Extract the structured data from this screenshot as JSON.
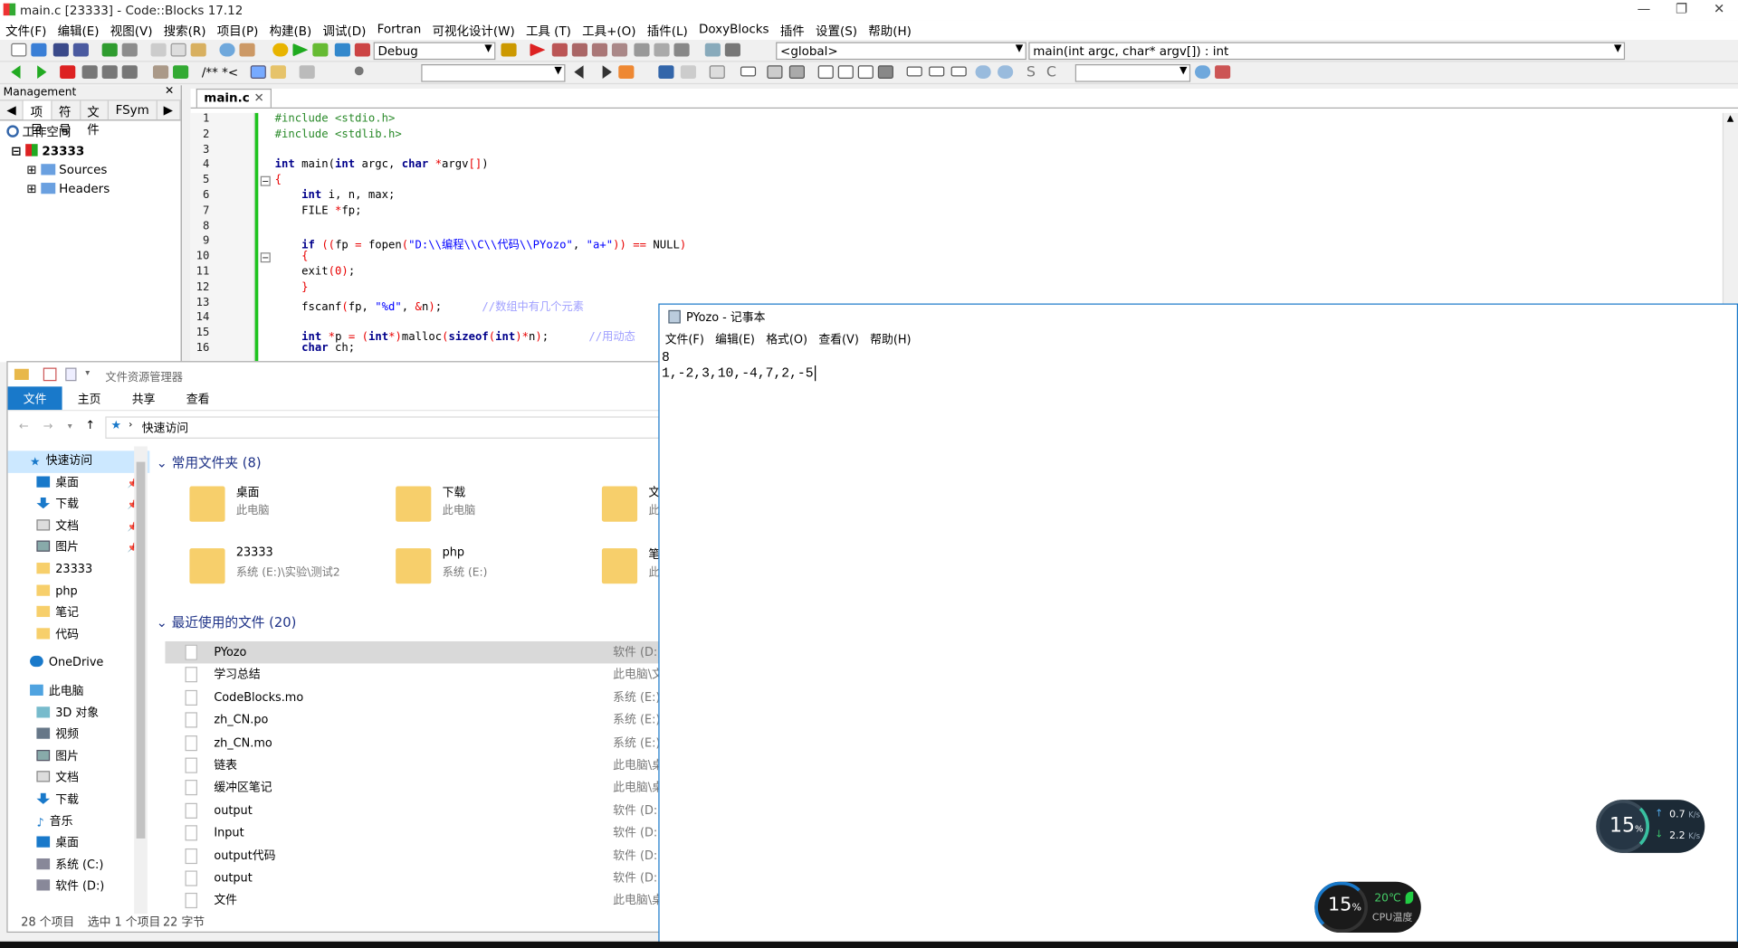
{
  "cb": {
    "title": "main.c [23333] - Code::Blocks 17.12",
    "menu": [
      "文件(F)",
      "编辑(E)",
      "视图(V)",
      "搜索(R)",
      "项目(P)",
      "构建(B)",
      "调试(D)",
      "Fortran",
      "可视化设计(W)",
      "工具 (T)",
      "工具+(O)",
      "插件(L)",
      "DoxyBlocks",
      "插件",
      "设置(S)",
      "帮助(H)"
    ],
    "build_target": "Debug",
    "scope": "<global>",
    "function": "main(int argc, char* argv[]) : int",
    "toolbar_comment": "/** *<",
    "management": {
      "header": "Management",
      "tabs": [
        "项目",
        "符号",
        "文件",
        "FSym"
      ],
      "workspace": "工作空间",
      "project": "23333",
      "sources": "Sources",
      "headers": "Headers"
    },
    "editor_tab": "main.c",
    "line_numbers": [
      "1",
      "2",
      "3",
      "4",
      "5",
      "6",
      "7",
      "8",
      "9",
      "10",
      "11",
      "12",
      "13",
      "14",
      "15",
      "16"
    ]
  },
  "explorer": {
    "title": "文件资源管理器",
    "ribbon": [
      "文件",
      "主页",
      "共享",
      "查看"
    ],
    "breadcrumb": "快速访问",
    "nav": [
      "快速访问",
      "桌面",
      "下载",
      "文档",
      "图片",
      "23333",
      "php",
      "笔记",
      "代码",
      "OneDrive",
      "此电脑",
      "3D 对象",
      "视频",
      "图片",
      "文档",
      "下载",
      "音乐",
      "桌面",
      "系统 (C:)",
      "软件 (D:)"
    ],
    "frequent_header": "常用文件夹 (8)",
    "tiles": [
      {
        "name": "桌面",
        "sub": "此电脑"
      },
      {
        "name": "下载",
        "sub": "此电脑"
      },
      {
        "name": "文档",
        "sub": "此电"
      },
      {
        "name": "23333",
        "sub": "系统 (E:)\\实验\\测试2"
      },
      {
        "name": "php",
        "sub": "系统 (E:)"
      },
      {
        "name": "笔记",
        "sub": "此电"
      }
    ],
    "recent_header": "最近使用的文件 (20)",
    "recent": [
      {
        "name": "PYozo",
        "loc": "软件 (D:)"
      },
      {
        "name": "学习总结",
        "loc": "此电脑\\文"
      },
      {
        "name": "CodeBlocks.mo",
        "loc": "系统 (E:)\\"
      },
      {
        "name": "zh_CN.po",
        "loc": "系统 (E:)\\"
      },
      {
        "name": "zh_CN.mo",
        "loc": "系统 (E:)\\"
      },
      {
        "name": "链表",
        "loc": "此电脑\\桌"
      },
      {
        "name": "缓冲区笔记",
        "loc": "此电脑\\桌"
      },
      {
        "name": "output",
        "loc": "软件 (D:)"
      },
      {
        "name": "Input",
        "loc": "软件 (D:)"
      },
      {
        "name": "output代码",
        "loc": "软件 (D:)"
      },
      {
        "name": "output",
        "loc": "软件 (D:)"
      },
      {
        "name": "文件",
        "loc": "此电脑\\桌"
      }
    ],
    "status": {
      "count": "28 个项目",
      "selected": "选中 1 个项目",
      "size": "22 字节"
    }
  },
  "notepad": {
    "title": "PYozo - 记事本",
    "menu": [
      "文件(F)",
      "编辑(E)",
      "格式(O)",
      "查看(V)",
      "帮助(H)"
    ],
    "line1": "8",
    "line2": "1,-2,3,10,-4,7,2,-5"
  },
  "widgets": {
    "net": {
      "percent": "15",
      "unit": "%",
      "up": "0.7",
      "up_unit": "K/s",
      "down": "2.2",
      "down_unit": "K/s"
    },
    "cpu": {
      "percent": "15",
      "unit": "%",
      "temp": "20℃",
      "label": "CPU温度"
    }
  },
  "colors": {
    "accent": "#1979ca",
    "green_marker": "#1ec41e",
    "keyword": "#00008b",
    "string": "#0000ff"
  }
}
